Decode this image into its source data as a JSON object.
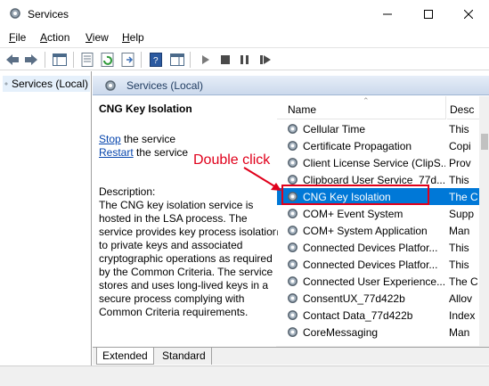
{
  "window": {
    "title": "Services"
  },
  "menu": {
    "file": "File",
    "action": "Action",
    "view": "View",
    "help": "Help"
  },
  "tree": {
    "item": "Services (Local)"
  },
  "header": {
    "title": "Services (Local)"
  },
  "details": {
    "service_name": "CNG Key Isolation",
    "stop_link": "Stop",
    "stop_suffix": " the service",
    "restart_link": "Restart",
    "restart_suffix": " the service",
    "description_label": "Description:",
    "description": "The CNG key isolation service is hosted in the LSA process. The service provides key process isolation to private keys and associated cryptographic operations as required by the Common Criteria. The service stores and uses long-lived keys in a secure process complying with Common Criteria requirements."
  },
  "list": {
    "col_name": "Name",
    "col_desc": "Desc",
    "rows": [
      {
        "name": "Cellular Time",
        "desc": "This"
      },
      {
        "name": "Certificate Propagation",
        "desc": "Copi"
      },
      {
        "name": "Client License Service (ClipS...",
        "desc": "Prov"
      },
      {
        "name": "Clipboard User Service_77d...",
        "desc": "This"
      },
      {
        "name": "CNG Key Isolation",
        "desc": "The C"
      },
      {
        "name": "COM+ Event System",
        "desc": "Supp"
      },
      {
        "name": "COM+ System Application",
        "desc": "Man"
      },
      {
        "name": "Connected Devices Platfor...",
        "desc": "This"
      },
      {
        "name": "Connected Devices Platfor...",
        "desc": "This"
      },
      {
        "name": "Connected User Experience...",
        "desc": "The C"
      },
      {
        "name": "ConsentUX_77d422b",
        "desc": "Allov"
      },
      {
        "name": "Contact Data_77d422b",
        "desc": "Index"
      },
      {
        "name": "CoreMessaging",
        "desc": "Man"
      }
    ],
    "selected_index": 4
  },
  "annotation": {
    "callout": "Double click"
  },
  "tabs": {
    "extended": "Extended",
    "standard": "Standard"
  },
  "colors": {
    "selection": "#0078d7",
    "annotation": "#e0001b",
    "link": "#0645ad"
  }
}
